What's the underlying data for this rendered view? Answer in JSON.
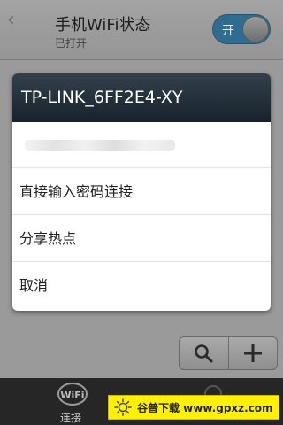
{
  "header": {
    "title": "手机WiFi状态",
    "subtitle": "已打开",
    "toggle_label": "开"
  },
  "dialog": {
    "title": "TP-LINK_6FF2E4-XY",
    "items": [
      "直接输入密码连接",
      "分享热点",
      "取消"
    ]
  },
  "bottom_bar": {
    "tabs": [
      {
        "label": "连接",
        "icon": "wifi-icon"
      }
    ]
  },
  "watermark": {
    "text": "谷普下载 www.gpxz.com"
  },
  "colors": {
    "dialog_title_bg": "#17222c",
    "toggle_on": "#2f6c92",
    "watermark_bg": "#fff100"
  }
}
